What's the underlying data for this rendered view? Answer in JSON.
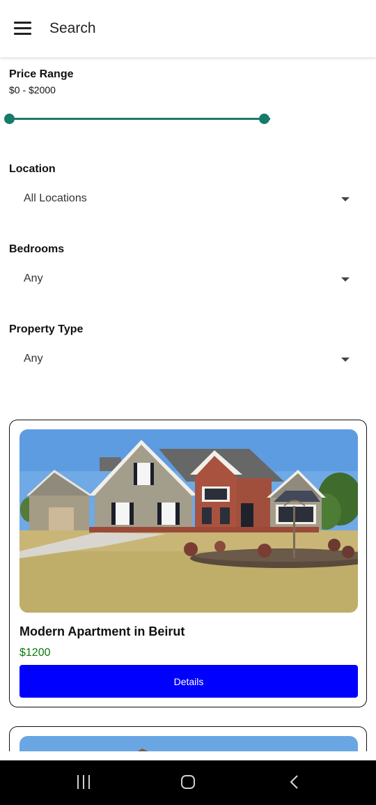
{
  "appbar": {
    "title": "Search"
  },
  "filters": {
    "price": {
      "label": "Price Range",
      "range_text": "$0 - $2000",
      "min_value": 0,
      "max_value": 2000,
      "low": 0,
      "high": 2000
    },
    "location": {
      "label": "Location",
      "value": "All Locations"
    },
    "bedrooms": {
      "label": "Bedrooms",
      "value": "Any"
    },
    "property_type": {
      "label": "Property Type",
      "value": "Any"
    }
  },
  "listings": [
    {
      "title": "Modern Apartment in Beirut",
      "price": "$1200",
      "button": "Details"
    }
  ],
  "colors": {
    "accent": "#177a6b",
    "button": "#0000ff",
    "price": "#0b7a0b"
  },
  "icons": {
    "menu": "menu-icon",
    "caret": "caret-down-icon",
    "nav": [
      "recents-icon",
      "home-icon",
      "back-icon"
    ]
  }
}
